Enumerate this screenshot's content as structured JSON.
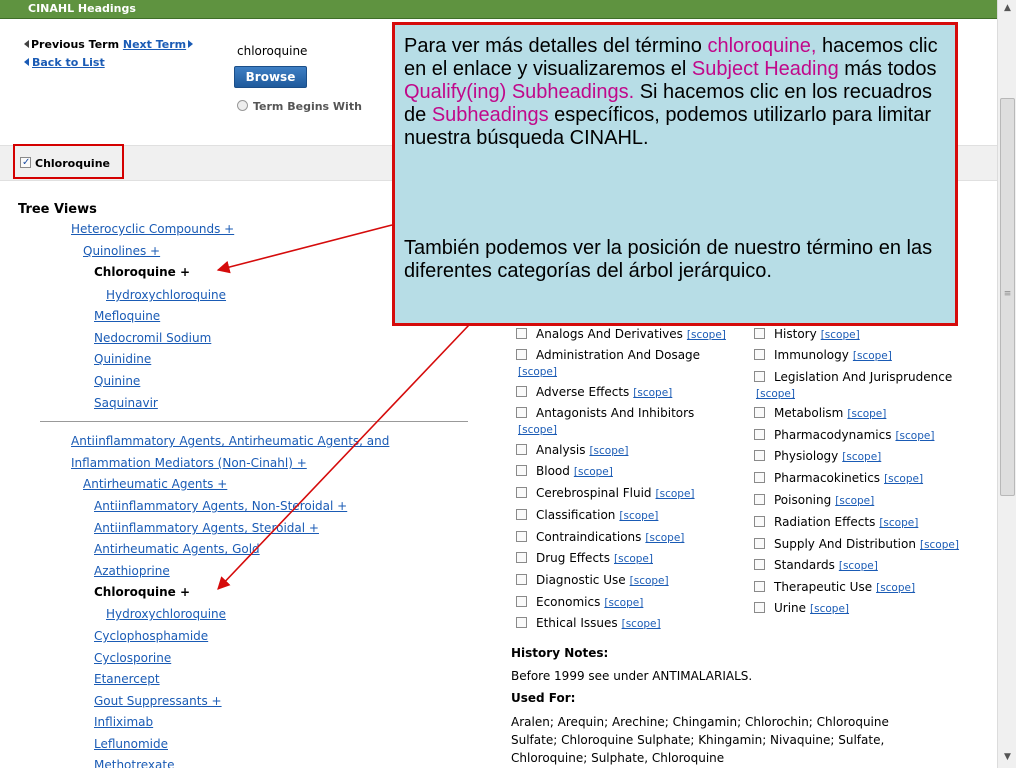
{
  "header": {
    "title": "CINAHL  Headings"
  },
  "nav": {
    "previous_term": "Previous Term",
    "next_term": "Next Term",
    "back_to_list": "Back to List"
  },
  "search": {
    "value": "chloroquine",
    "browse_label": "Browse",
    "term_begins_with": "Term Begins With"
  },
  "selected_heading": {
    "label": "Chloroquine",
    "checked": true
  },
  "tree": {
    "title": "Tree Views",
    "group1": [
      {
        "label": "Heterocyclic Compounds +",
        "link": true
      },
      {
        "label": "Quinolines +",
        "link": true
      },
      {
        "label": "Chloroquine +",
        "link": false
      },
      {
        "label": "Hydroxychloroquine",
        "link": true
      },
      {
        "label": "Mefloquine",
        "link": true
      },
      {
        "label": "Nedocromil Sodium",
        "link": true
      },
      {
        "label": "Quinidine",
        "link": true
      },
      {
        "label": "Quinine",
        "link": true
      },
      {
        "label": "Saquinavir",
        "link": true
      }
    ],
    "group2": [
      {
        "label": "Antiinflammatory Agents, Antirheumatic Agents, and",
        "link": true
      },
      {
        "label": "Inflammation Mediators (Non-Cinahl) +",
        "link": true
      },
      {
        "label": "Antirheumatic Agents +",
        "link": true
      },
      {
        "label": "Antiinflammatory Agents, Non-Steroidal +",
        "link": true
      },
      {
        "label": "Antiinflammatory Agents, Steroidal +",
        "link": true
      },
      {
        "label": "Antirheumatic Agents, Gold",
        "link": true
      },
      {
        "label": "Azathioprine",
        "link": true
      },
      {
        "label": "Chloroquine +",
        "link": false
      },
      {
        "label": "Hydroxychloroquine",
        "link": true
      },
      {
        "label": "Cyclophosphamide",
        "link": true
      },
      {
        "label": "Cyclosporine",
        "link": true
      },
      {
        "label": "Etanercept",
        "link": true
      },
      {
        "label": "Gout Suppressants +",
        "link": true
      },
      {
        "label": "Infliximab",
        "link": true
      },
      {
        "label": "Leflunomide",
        "link": true
      },
      {
        "label": "Methotrexate",
        "link": true
      }
    ]
  },
  "subheadings": {
    "scope_label": "[scope]",
    "left": [
      "Analogs And Derivatives",
      "Administration And Dosage",
      "Adverse Effects",
      "Antagonists And Inhibitors",
      "Analysis",
      "Blood",
      "Cerebrospinal Fluid",
      "Classification",
      "Contraindications",
      "Drug Effects",
      "Diagnostic Use",
      "Economics",
      "Ethical Issues"
    ],
    "right": [
      "History",
      "Immunology",
      "Legislation And Jurisprudence",
      "Metabolism",
      "Pharmacodynamics",
      "Physiology",
      "Pharmacokinetics",
      "Poisoning",
      "Radiation Effects",
      "Supply And Distribution",
      "Standards",
      "Therapeutic Use",
      "Urine"
    ]
  },
  "notes": {
    "history_title": "History Notes:",
    "history_text": "Before 1999 see under ANTIMALARIALS.",
    "used_for_title": "Used For:",
    "used_for_lines": [
      "Aralen; Arequin; Arechine; Chingamin; Chlorochin; Chloroquine",
      "Sulfate; Chloroquine Sulphate; Khingamin; Nivaquine; Sulfate,",
      "Chloroquine; Sulphate, Chloroquine"
    ]
  },
  "callout": {
    "p1": {
      "a": "Para ver más detalles del término ",
      "b": "chloroquine,",
      "c": " hacemos clic en el enlace y visualizaremos el ",
      "d": "Subject Heading",
      "e": " más todos ",
      "f": "Qualify(ing) Subheadings.",
      "g": "  Si hacemos clic en los recuadros de ",
      "h": "Subheadings",
      "i": " específicos, podemos utilizarlo para limitar nuestra búsqueda CINAHL."
    },
    "p2": "También podemos ver la posición de nuestro término en las diferentes categorías del árbol jerárquico."
  },
  "colors": {
    "header_green": "#5f9340",
    "link_blue": "#1a5bb5",
    "callout_bg": "#b7dde6",
    "callout_border": "#d50b0b",
    "highlight_pink": "#c0088a"
  }
}
